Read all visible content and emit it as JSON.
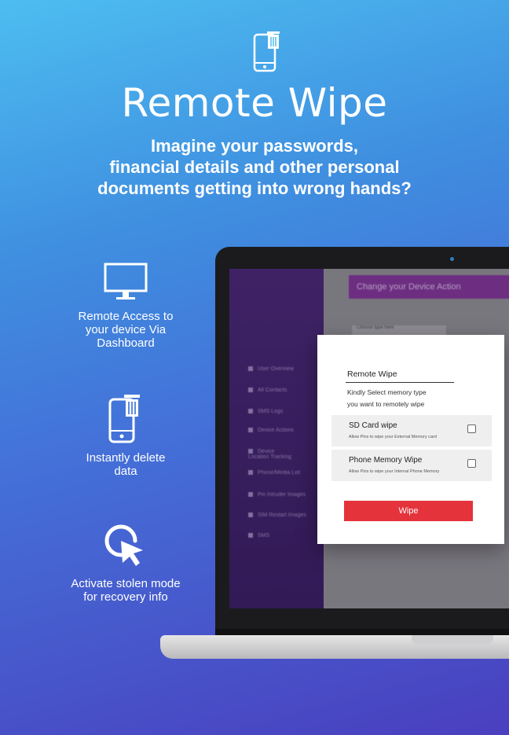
{
  "hero": {
    "icon": "phone-trash-icon",
    "title": "Remote Wipe",
    "subtitle_lines": [
      "Imagine your passwords,",
      "financial details and other personal",
      "documents getting into wrong hands?"
    ]
  },
  "features": [
    {
      "icon": "monitor-icon",
      "label_lines": [
        "Remote Access to",
        "your device Via",
        "Dashboard"
      ]
    },
    {
      "icon": "phone-trash-icon",
      "label_lines": [
        "Instantly delete",
        "data"
      ]
    },
    {
      "icon": "cursor-click-icon",
      "label_lines": [
        "Activate stolen mode",
        "for recovery info"
      ]
    }
  ],
  "screen": {
    "header": "Change your Device Action",
    "field_placeholder": "Choose type here",
    "sidebar_items": [
      "User Overview",
      "All Contacts",
      "SMS Logs",
      "Device Actions",
      "Device Location Tracking",
      "Phone/Media List",
      "Pin Intruder Images",
      "SIM Restart Images",
      "SMS"
    ]
  },
  "dialog": {
    "title": "Remote Wipe",
    "description_lines": [
      "Kindly Select  memory type",
      "you want to remotely wipe"
    ],
    "options": [
      {
        "label": "SD Card wipe",
        "description": "Allow Pins to wipe your External Memory card",
        "checked": false
      },
      {
        "label": "Phone Memory Wipe",
        "description": "Allow Pins to wipe your Internal Phone Memory",
        "checked": false
      }
    ],
    "button_label": "Wipe"
  },
  "colors": {
    "accent_red": "#e5333b",
    "sidebar_purple": "#4d2a7a",
    "header_purple": "#8b3aa0"
  }
}
